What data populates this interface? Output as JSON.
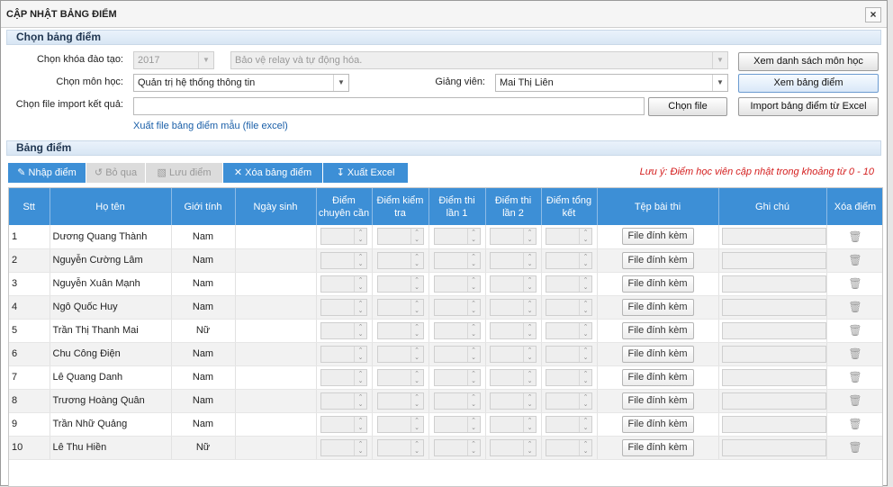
{
  "dialog": {
    "title": "CẬP NHẬT BẢNG ĐIỂM",
    "close": "×"
  },
  "select_section": {
    "heading": "Chọn bảng điểm",
    "course_label": "Chọn khóa đào tạo:",
    "course_year": "2017",
    "course_name": "Bảo vệ relay và tự động hóa.",
    "subject_label": "Chọn môn học:",
    "subject_value": "Quản trị hệ thống thông tin",
    "lecturer_label": "Giảng viên:",
    "lecturer_value": "Mai Thị Liên",
    "import_label": "Chọn file import kết quả:",
    "import_value": "",
    "choose_file_btn": "Chọn file",
    "export_template_link": "Xuất file bảng điểm mẫu (file excel)",
    "view_subjects_btn": "Xem danh sách môn học",
    "view_grades_btn": "Xem bảng điểm",
    "import_excel_btn": "Import bảng điểm từ Excel"
  },
  "grades_section": {
    "heading": "Bảng điểm",
    "toolbar": {
      "enter": "Nhập điểm",
      "skip": "Bỏ qua",
      "save": "Lưu điểm",
      "delete": "Xóa bảng điểm",
      "export": "Xuất Excel"
    },
    "note": "Lưu ý: Điểm học viên cập nhật trong khoảng từ 0 - 10",
    "columns": [
      "Stt",
      "Họ tên",
      "Giới tính",
      "Ngày sinh",
      "Điểm chuyên cần",
      "Điểm kiểm tra",
      "Điểm thi lần 1",
      "Điểm thi lần 2",
      "Điểm tổng kết",
      "Tệp bài thi",
      "Ghi chú",
      "Xóa điểm"
    ],
    "attach_label": "File đính kèm",
    "rows": [
      {
        "stt": "1",
        "name": "Dương Quang Thành",
        "gender": "Nam",
        "dob": ""
      },
      {
        "stt": "2",
        "name": "Nguyễn Cường Lâm",
        "gender": "Nam",
        "dob": ""
      },
      {
        "stt": "3",
        "name": "Nguyễn Xuân Mạnh",
        "gender": "Nam",
        "dob": ""
      },
      {
        "stt": "4",
        "name": "Ngô Quốc Huy",
        "gender": "Nam",
        "dob": ""
      },
      {
        "stt": "5",
        "name": "Trần Thị Thanh Mai",
        "gender": "Nữ",
        "dob": ""
      },
      {
        "stt": "6",
        "name": "Chu Công Điện",
        "gender": "Nam",
        "dob": ""
      },
      {
        "stt": "7",
        "name": "Lê Quang Danh",
        "gender": "Nam",
        "dob": ""
      },
      {
        "stt": "8",
        "name": "Trương Hoàng Quân",
        "gender": "Nam",
        "dob": ""
      },
      {
        "stt": "9",
        "name": "Trần Nhữ Quảng",
        "gender": "Nam",
        "dob": ""
      },
      {
        "stt": "10",
        "name": "Lê Thu Hiền",
        "gender": "Nữ",
        "dob": ""
      }
    ]
  },
  "colors": {
    "header_blue": "#3d8fd6",
    "note_red": "#d41e1e",
    "link_blue": "#1a5fa8"
  }
}
